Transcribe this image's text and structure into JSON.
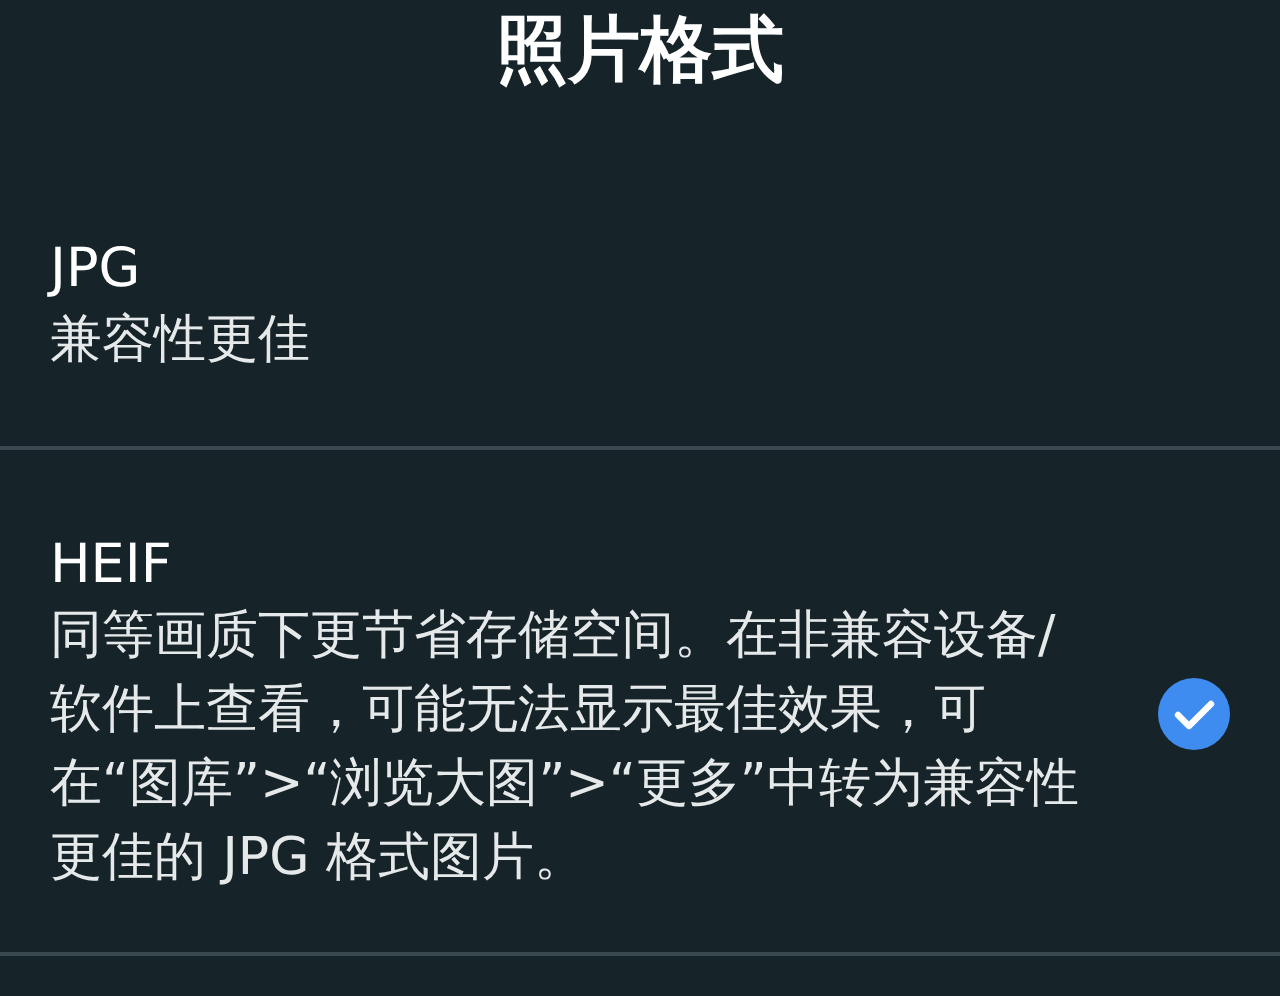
{
  "title": "照片格式",
  "options": [
    {
      "name": "JPG",
      "description": "兼容性更佳",
      "selected": false
    },
    {
      "name": "HEIF",
      "description": "同等画质下更节省存储空间。在非兼容设备/软件上查看，可能无法显示最佳效果，可在“图库”>“浏览大图”>“更多”中转为兼容性更佳的 JPG 格式图片。",
      "selected": true
    }
  ]
}
